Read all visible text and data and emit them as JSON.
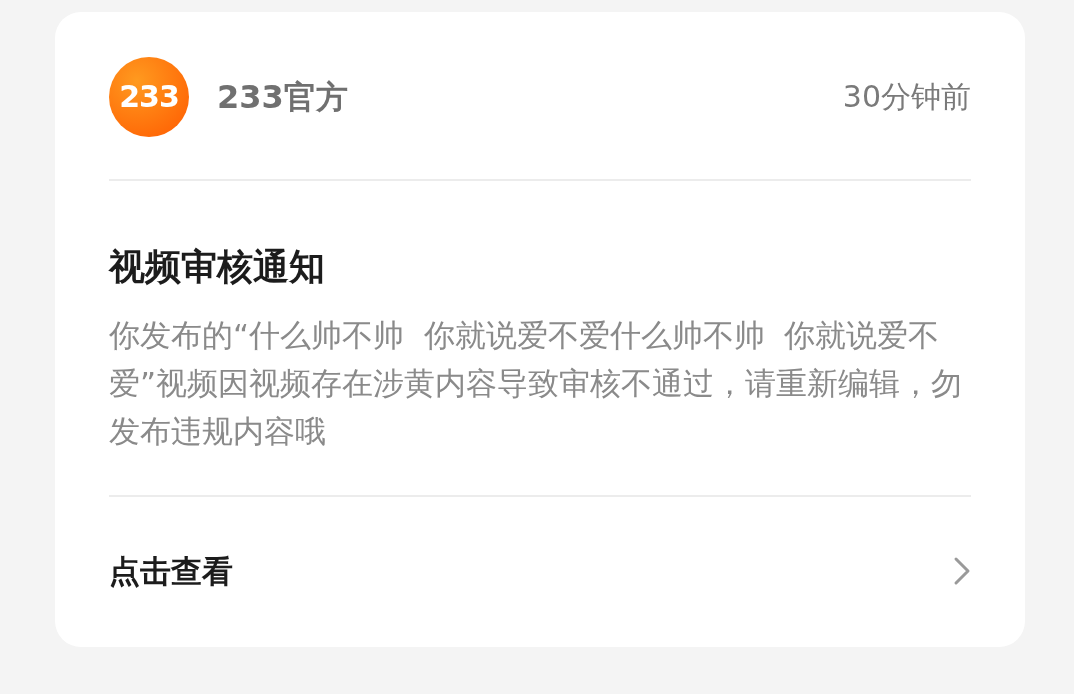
{
  "sender": {
    "logo_text": "233",
    "name": "233官方",
    "time": "30分钟前"
  },
  "notice": {
    "title": "视频审核通知",
    "body": "你发布的“什么帅不帅  你就说爱不爱什么帅不帅  你就说爱不爱”视频因视频存在涉黄内容导致审核不通过，请重新编辑，勿发布违规内容哦"
  },
  "action": {
    "label": "点击查看"
  }
}
